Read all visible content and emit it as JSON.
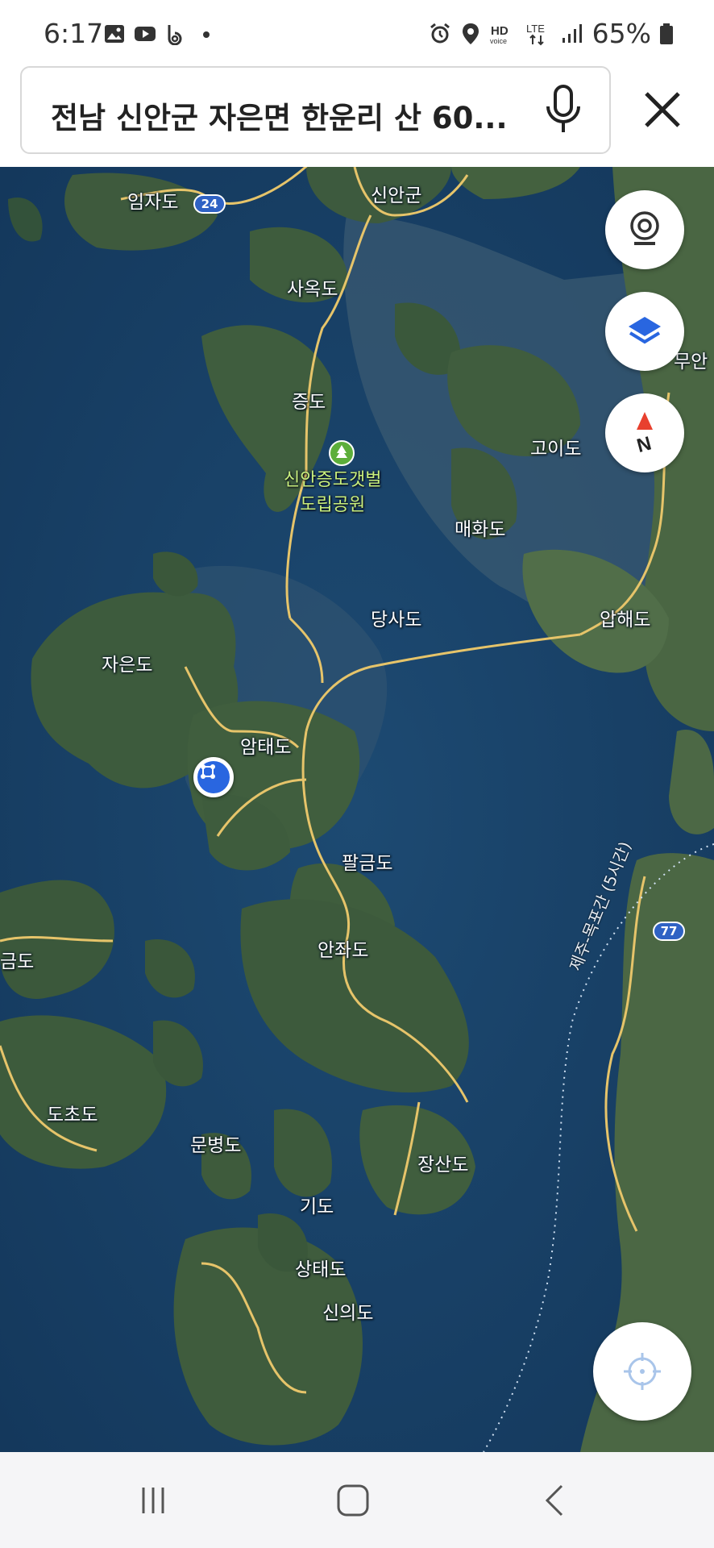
{
  "status_bar": {
    "time": "6:17",
    "battery": "65%",
    "left_icons": [
      "gallery-icon",
      "youtube-icon",
      "b-app-icon",
      "dot-icon"
    ],
    "right_icons": [
      "alarm-icon",
      "location-icon",
      "hd-voice-icon",
      "lte-icon",
      "signal-icon",
      "battery-icon"
    ]
  },
  "search": {
    "query": "전남 신안군 자은면 한운리 산 60..."
  },
  "map": {
    "view": "satellite",
    "labels": {
      "imjado": "임자도",
      "sinangun": "신안군",
      "saokdo": "사옥도",
      "jeungdo": "증도",
      "park_line1": "신안증도갯벌",
      "park_line2": "도립공원",
      "goido": "고이도",
      "maehwado": "매화도",
      "muan": "무안",
      "danagsado": "당사도",
      "aphaedo": "압해도",
      "jaeundo": "자은도",
      "amtaedo": "암태도",
      "palgeumdo": "팔금도",
      "anjwado": "안좌도",
      "geumdo_partial": "금도",
      "dochodo": "도초도",
      "munbyeongdo": "문병도",
      "jangsando": "장산도",
      "gido": "기도",
      "sangtaedo": "상태도",
      "sinuido": "신의도",
      "ferry_route": "제주-목포간 (5시간)"
    },
    "route_badges": {
      "r24": "24",
      "r77": "77"
    },
    "colors": {
      "sea": "#163d62",
      "land": "#3c5a3e",
      "road": "#e6c46a",
      "marker": "#2966e0"
    }
  },
  "controls": {
    "street_view": "street-view-icon",
    "layers": "layers-icon",
    "compass": "compass-north-icon",
    "compass_letter": "N",
    "my_location": "crosshair-icon"
  },
  "nav": {
    "recent": "recent-apps-icon",
    "home": "home-icon",
    "back": "back-icon"
  }
}
